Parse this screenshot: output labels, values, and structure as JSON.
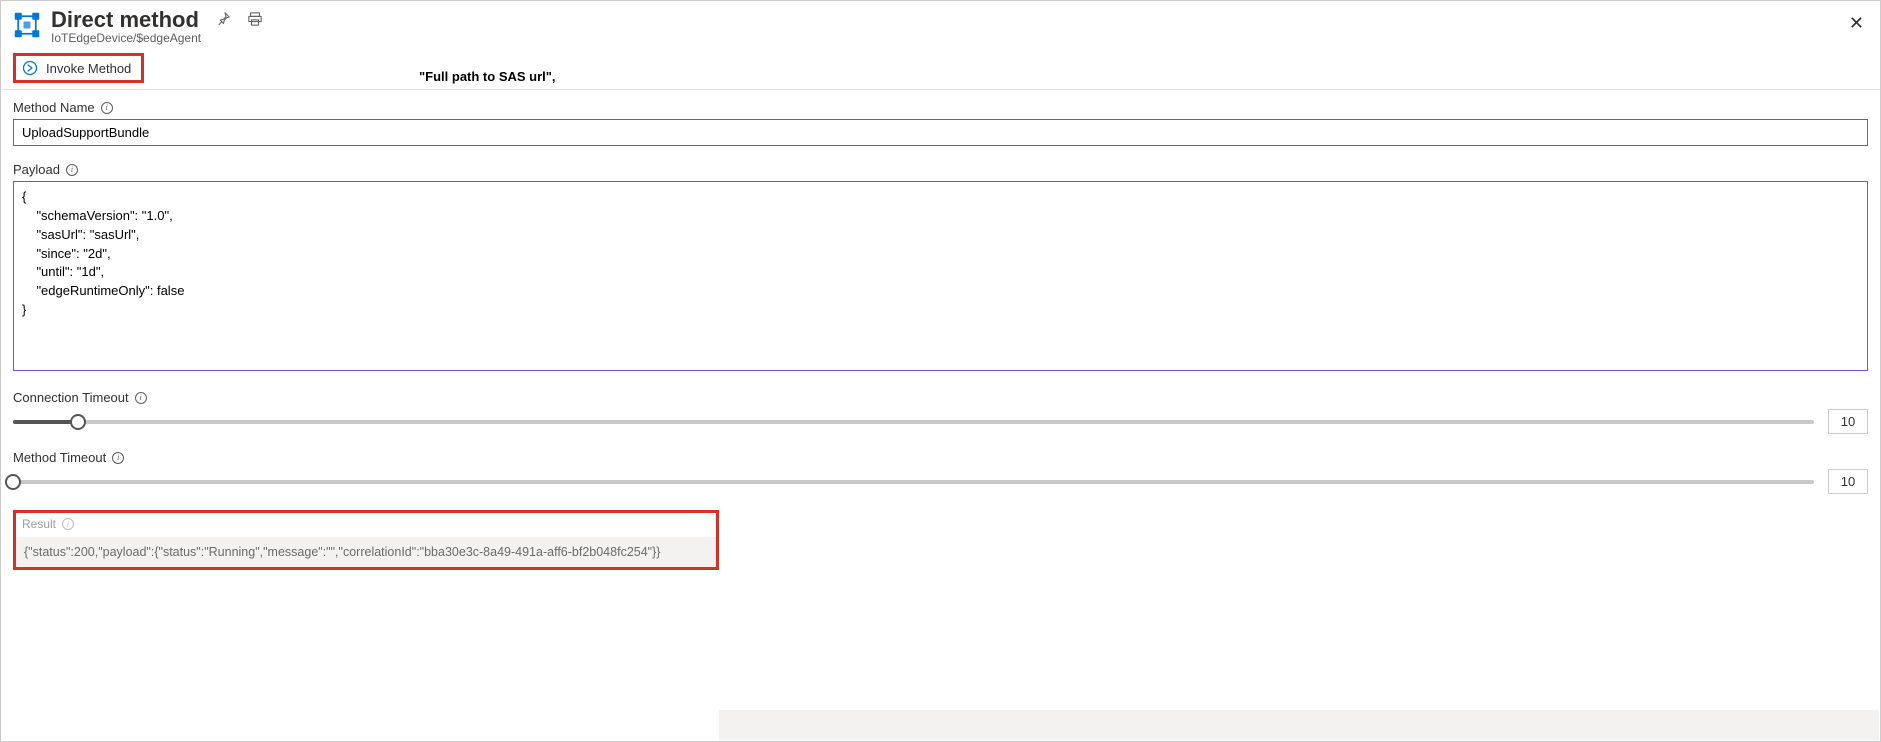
{
  "header": {
    "title": "Direct method",
    "subtitle": "IoTEdgeDevice/$edgeAgent"
  },
  "floating_note": "\"Full path to SAS url\",",
  "toolbar": {
    "invoke_label": "Invoke Method"
  },
  "fields": {
    "method_name": {
      "label": "Method Name",
      "value": "UploadSupportBundle"
    },
    "payload": {
      "label": "Payload",
      "value": "{\n    \"schemaVersion\": \"1.0\",\n    \"sasUrl\": \"sasUrl\",\n    \"since\": \"2d\",\n    \"until\": \"1d\",\n    \"edgeRuntimeOnly\": false\n}"
    },
    "connection_timeout": {
      "label": "Connection Timeout",
      "value": "10",
      "fill_percent": 3.6
    },
    "method_timeout": {
      "label": "Method Timeout",
      "value": "10",
      "fill_percent": 0
    }
  },
  "result": {
    "label": "Result",
    "text": "{\"status\":200,\"payload\":{\"status\":\"Running\",\"message\":\"\",\"correlationId\":\"bba30e3c-8a49-491a-aff6-bf2b048fc254\"}}"
  }
}
